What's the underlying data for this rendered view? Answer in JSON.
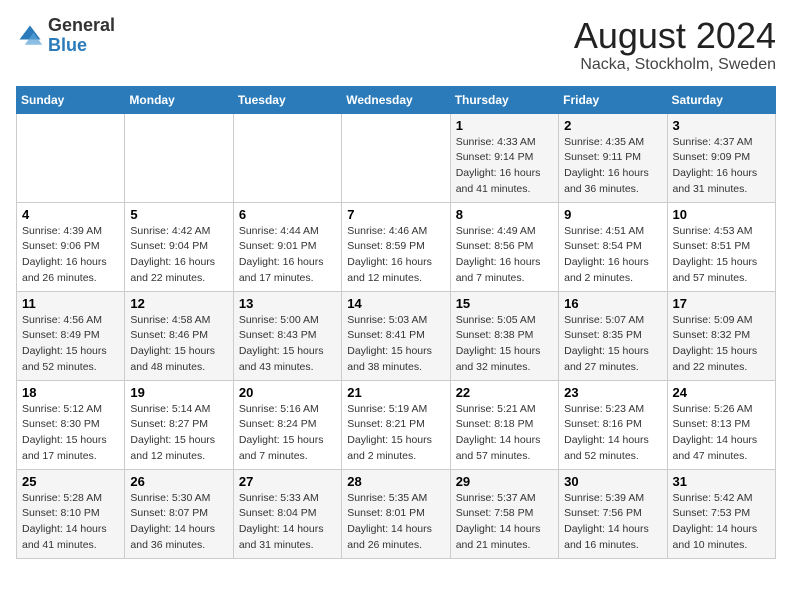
{
  "header": {
    "logo_general": "General",
    "logo_blue": "Blue",
    "title": "August 2024",
    "subtitle": "Nacka, Stockholm, Sweden"
  },
  "weekdays": [
    "Sunday",
    "Monday",
    "Tuesday",
    "Wednesday",
    "Thursday",
    "Friday",
    "Saturday"
  ],
  "weeks": [
    [
      {
        "day": "",
        "sunrise": "",
        "sunset": "",
        "daylight": ""
      },
      {
        "day": "",
        "sunrise": "",
        "sunset": "",
        "daylight": ""
      },
      {
        "day": "",
        "sunrise": "",
        "sunset": "",
        "daylight": ""
      },
      {
        "day": "",
        "sunrise": "",
        "sunset": "",
        "daylight": ""
      },
      {
        "day": "1",
        "sunrise": "Sunrise: 4:33 AM",
        "sunset": "Sunset: 9:14 PM",
        "daylight": "Daylight: 16 hours and 41 minutes."
      },
      {
        "day": "2",
        "sunrise": "Sunrise: 4:35 AM",
        "sunset": "Sunset: 9:11 PM",
        "daylight": "Daylight: 16 hours and 36 minutes."
      },
      {
        "day": "3",
        "sunrise": "Sunrise: 4:37 AM",
        "sunset": "Sunset: 9:09 PM",
        "daylight": "Daylight: 16 hours and 31 minutes."
      }
    ],
    [
      {
        "day": "4",
        "sunrise": "Sunrise: 4:39 AM",
        "sunset": "Sunset: 9:06 PM",
        "daylight": "Daylight: 16 hours and 26 minutes."
      },
      {
        "day": "5",
        "sunrise": "Sunrise: 4:42 AM",
        "sunset": "Sunset: 9:04 PM",
        "daylight": "Daylight: 16 hours and 22 minutes."
      },
      {
        "day": "6",
        "sunrise": "Sunrise: 4:44 AM",
        "sunset": "Sunset: 9:01 PM",
        "daylight": "Daylight: 16 hours and 17 minutes."
      },
      {
        "day": "7",
        "sunrise": "Sunrise: 4:46 AM",
        "sunset": "Sunset: 8:59 PM",
        "daylight": "Daylight: 16 hours and 12 minutes."
      },
      {
        "day": "8",
        "sunrise": "Sunrise: 4:49 AM",
        "sunset": "Sunset: 8:56 PM",
        "daylight": "Daylight: 16 hours and 7 minutes."
      },
      {
        "day": "9",
        "sunrise": "Sunrise: 4:51 AM",
        "sunset": "Sunset: 8:54 PM",
        "daylight": "Daylight: 16 hours and 2 minutes."
      },
      {
        "day": "10",
        "sunrise": "Sunrise: 4:53 AM",
        "sunset": "Sunset: 8:51 PM",
        "daylight": "Daylight: 15 hours and 57 minutes."
      }
    ],
    [
      {
        "day": "11",
        "sunrise": "Sunrise: 4:56 AM",
        "sunset": "Sunset: 8:49 PM",
        "daylight": "Daylight: 15 hours and 52 minutes."
      },
      {
        "day": "12",
        "sunrise": "Sunrise: 4:58 AM",
        "sunset": "Sunset: 8:46 PM",
        "daylight": "Daylight: 15 hours and 48 minutes."
      },
      {
        "day": "13",
        "sunrise": "Sunrise: 5:00 AM",
        "sunset": "Sunset: 8:43 PM",
        "daylight": "Daylight: 15 hours and 43 minutes."
      },
      {
        "day": "14",
        "sunrise": "Sunrise: 5:03 AM",
        "sunset": "Sunset: 8:41 PM",
        "daylight": "Daylight: 15 hours and 38 minutes."
      },
      {
        "day": "15",
        "sunrise": "Sunrise: 5:05 AM",
        "sunset": "Sunset: 8:38 PM",
        "daylight": "Daylight: 15 hours and 32 minutes."
      },
      {
        "day": "16",
        "sunrise": "Sunrise: 5:07 AM",
        "sunset": "Sunset: 8:35 PM",
        "daylight": "Daylight: 15 hours and 27 minutes."
      },
      {
        "day": "17",
        "sunrise": "Sunrise: 5:09 AM",
        "sunset": "Sunset: 8:32 PM",
        "daylight": "Daylight: 15 hours and 22 minutes."
      }
    ],
    [
      {
        "day": "18",
        "sunrise": "Sunrise: 5:12 AM",
        "sunset": "Sunset: 8:30 PM",
        "daylight": "Daylight: 15 hours and 17 minutes."
      },
      {
        "day": "19",
        "sunrise": "Sunrise: 5:14 AM",
        "sunset": "Sunset: 8:27 PM",
        "daylight": "Daylight: 15 hours and 12 minutes."
      },
      {
        "day": "20",
        "sunrise": "Sunrise: 5:16 AM",
        "sunset": "Sunset: 8:24 PM",
        "daylight": "Daylight: 15 hours and 7 minutes."
      },
      {
        "day": "21",
        "sunrise": "Sunrise: 5:19 AM",
        "sunset": "Sunset: 8:21 PM",
        "daylight": "Daylight: 15 hours and 2 minutes."
      },
      {
        "day": "22",
        "sunrise": "Sunrise: 5:21 AM",
        "sunset": "Sunset: 8:18 PM",
        "daylight": "Daylight: 14 hours and 57 minutes."
      },
      {
        "day": "23",
        "sunrise": "Sunrise: 5:23 AM",
        "sunset": "Sunset: 8:16 PM",
        "daylight": "Daylight: 14 hours and 52 minutes."
      },
      {
        "day": "24",
        "sunrise": "Sunrise: 5:26 AM",
        "sunset": "Sunset: 8:13 PM",
        "daylight": "Daylight: 14 hours and 47 minutes."
      }
    ],
    [
      {
        "day": "25",
        "sunrise": "Sunrise: 5:28 AM",
        "sunset": "Sunset: 8:10 PM",
        "daylight": "Daylight: 14 hours and 41 minutes."
      },
      {
        "day": "26",
        "sunrise": "Sunrise: 5:30 AM",
        "sunset": "Sunset: 8:07 PM",
        "daylight": "Daylight: 14 hours and 36 minutes."
      },
      {
        "day": "27",
        "sunrise": "Sunrise: 5:33 AM",
        "sunset": "Sunset: 8:04 PM",
        "daylight": "Daylight: 14 hours and 31 minutes."
      },
      {
        "day": "28",
        "sunrise": "Sunrise: 5:35 AM",
        "sunset": "Sunset: 8:01 PM",
        "daylight": "Daylight: 14 hours and 26 minutes."
      },
      {
        "day": "29",
        "sunrise": "Sunrise: 5:37 AM",
        "sunset": "Sunset: 7:58 PM",
        "daylight": "Daylight: 14 hours and 21 minutes."
      },
      {
        "day": "30",
        "sunrise": "Sunrise: 5:39 AM",
        "sunset": "Sunset: 7:56 PM",
        "daylight": "Daylight: 14 hours and 16 minutes."
      },
      {
        "day": "31",
        "sunrise": "Sunrise: 5:42 AM",
        "sunset": "Sunset: 7:53 PM",
        "daylight": "Daylight: 14 hours and 10 minutes."
      }
    ]
  ]
}
